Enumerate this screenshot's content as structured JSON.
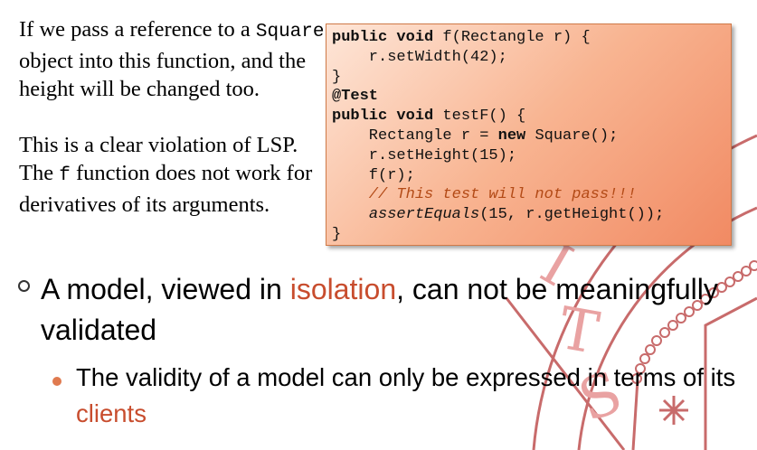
{
  "paragraph1": {
    "text_before": "If we pass a reference to a ",
    "code_word": "Square",
    "text_after": " object into this function, and the height will be changed too."
  },
  "paragraph2": {
    "text_before": "This is a clear violation of LSP. The ",
    "code_word": "f",
    "text_after": " function does not work for derivatives of its arguments."
  },
  "code": {
    "l1_kw": "public void",
    "l1_rest": " f(Rectangle r) {",
    "l2": "    r.setWidth(42);",
    "l3": "}",
    "l4": "@Test",
    "l5_kw": "public void",
    "l5_rest": " testF() {",
    "l6_a": "    Rectangle r = ",
    "l6_kw": "new",
    "l6_b": " Square();",
    "l7": "    r.setHeight(15);",
    "l8": "    f(r);",
    "l9": "    // This test will not pass!!!",
    "l10_indent": "    ",
    "l10_it": "assertEquals",
    "l10_rest": "(15, r.getHeight());",
    "l11": "}"
  },
  "bullet1": {
    "text_before": "A model, viewed in ",
    "highlight": "isolation",
    "text_after": ", can not be meaningfully validated"
  },
  "bullet2": {
    "text_before": "The validity of a model can only be expressed in terms of its ",
    "highlight": "clients"
  },
  "colors": {
    "accent": "#c84d2e",
    "seal": "#c86b6b",
    "code_bg_start": "#fee6d8",
    "code_bg_end": "#f18a63"
  }
}
